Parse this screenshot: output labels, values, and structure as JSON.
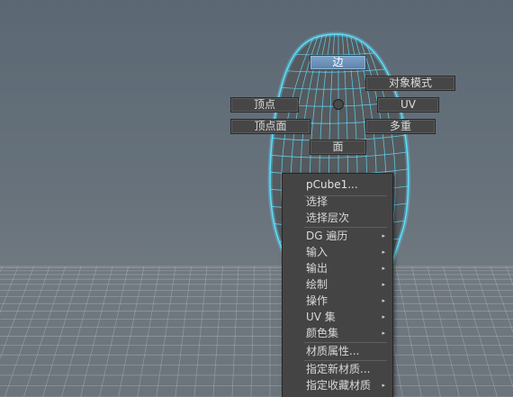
{
  "colors": {
    "wire": "#5fe0ff",
    "mesh_face": "#555a5e",
    "grid": "#b9bcbf",
    "active_button": "#6a8fb6"
  },
  "marking_menu": {
    "north": "边",
    "north_east": "对象模式",
    "west": "顶点",
    "east": "UV",
    "south_west": "顶点面",
    "south_east": "多重",
    "south": "面",
    "center_icon": "circle-icon"
  },
  "context_menu": {
    "header": "pCube1...",
    "group1": [
      "选择",
      "选择层次"
    ],
    "submenus": [
      "DG 遍历",
      "输入",
      "输出",
      "绘制",
      "操作",
      "UV 集",
      "颜色集"
    ],
    "material_attr": "材质属性...",
    "group3": [
      "指定新材质...",
      "指定收藏材质"
    ],
    "submenu_arrow": "▸"
  }
}
